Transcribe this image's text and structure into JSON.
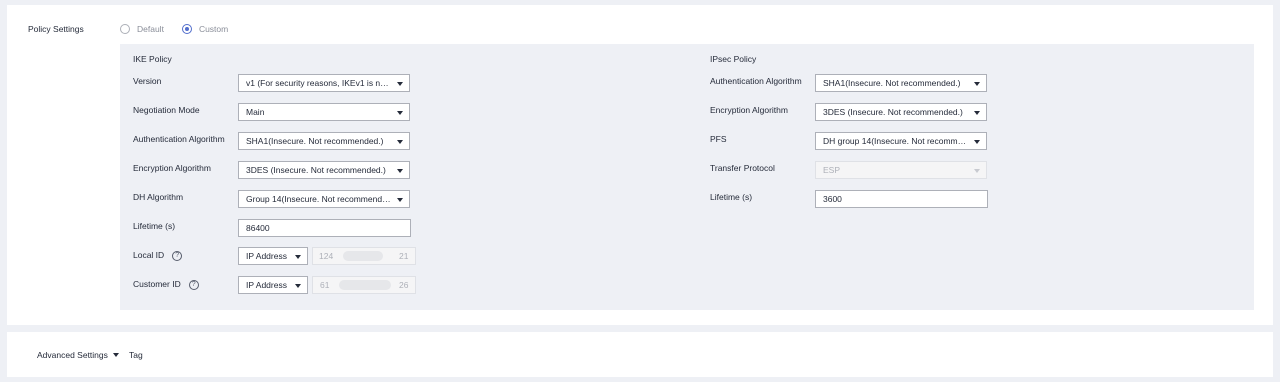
{
  "policy_settings": {
    "label": "Policy Settings",
    "options": [
      {
        "label": "Default",
        "selected": false
      },
      {
        "label": "Custom",
        "selected": true
      }
    ]
  },
  "ike": {
    "title": "IKE Policy",
    "version": {
      "label": "Version",
      "value": "v1 (For security reasons, IKEv1 is not r..."
    },
    "negotiation_mode": {
      "label": "Negotiation Mode",
      "value": "Main"
    },
    "auth_algorithm": {
      "label": "Authentication Algorithm",
      "value": "SHA1(Insecure. Not recommended.)"
    },
    "encryption_algorithm": {
      "label": "Encryption Algorithm",
      "value": "3DES (Insecure. Not recommended.)"
    },
    "dh_algorithm": {
      "label": "DH Algorithm",
      "value": "Group 14(Insecure. Not recommende..."
    },
    "lifetime": {
      "label": "Lifetime (s)",
      "value": "86400"
    },
    "local_id": {
      "label": "Local ID",
      "type": "IP Address",
      "ip_first": "124",
      "ip_last": "21"
    },
    "customer_id": {
      "label": "Customer ID",
      "type": "IP Address",
      "ip_first": "61",
      "ip_last": "26"
    }
  },
  "ipsec": {
    "title": "IPsec Policy",
    "auth_algorithm": {
      "label": "Authentication Algorithm",
      "value": "SHA1(Insecure. Not recommended.)"
    },
    "encryption_algorithm": {
      "label": "Encryption Algorithm",
      "value": "3DES (Insecure. Not recommended.)"
    },
    "pfs": {
      "label": "PFS",
      "value": "DH group 14(Insecure. Not recomme..."
    },
    "transfer_protocol": {
      "label": "Transfer Protocol",
      "value": "ESP"
    },
    "lifetime": {
      "label": "Lifetime (s)",
      "value": "3600"
    }
  },
  "footer": {
    "advanced_settings": "Advanced Settings",
    "tag": "Tag"
  },
  "icons": {
    "help": "?"
  },
  "colors": {
    "accent": "#526ecc",
    "panel_bg": "#eef0f5"
  }
}
